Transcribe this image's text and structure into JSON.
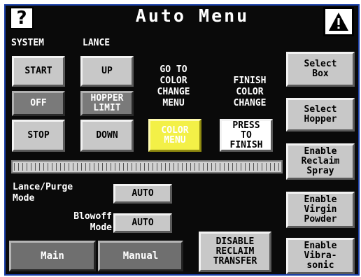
{
  "header": {
    "help_icon": "question-mark-icon",
    "help_label": "?",
    "title": "Auto Menu",
    "alarm_icon": "warning-triangle-icon"
  },
  "system": {
    "label": "SYSTEM",
    "start": "START",
    "status": "OFF",
    "stop": "STOP"
  },
  "lance": {
    "label": "LANCE",
    "up": "UP",
    "hopper_limit": "HOPPER\nLIMIT",
    "down": "DOWN"
  },
  "color_change": {
    "goto_label": "GO TO\nCOLOR\nCHANGE\nMENU",
    "menu_button": "COLOR\nMENU",
    "finish_label": "FINISH\nCOLOR\nCHANGE",
    "finish_button": "PRESS\nTO\nFINISH"
  },
  "right_buttons": {
    "select_box": "Select\nBox",
    "select_hopper": "Select\nHopper",
    "enable_reclaim_spray": "Enable\nReclaim\nSpray",
    "enable_virgin_powder": "Enable\nVirgin\nPowder",
    "enable_vibrasonic": "Enable\nVibra-\nsonic"
  },
  "modes": {
    "lance_purge_label": "Lance/Purge\nMode",
    "lance_purge_value": "AUTO",
    "blowoff_label": "Blowoff\nMode",
    "blowoff_value": "AUTO"
  },
  "bottom": {
    "main": "Main",
    "manual": "Manual",
    "disable_reclaim": "DISABLE\nRECLAIM\nTRANSFER"
  },
  "colors": {
    "panel_bg": "#0a0a0a",
    "button_gray": "#c8c8c8",
    "status_gray": "#7a7a7a",
    "highlight_yellow": "#f3f047",
    "frame_blue": "#1a3fa8"
  }
}
